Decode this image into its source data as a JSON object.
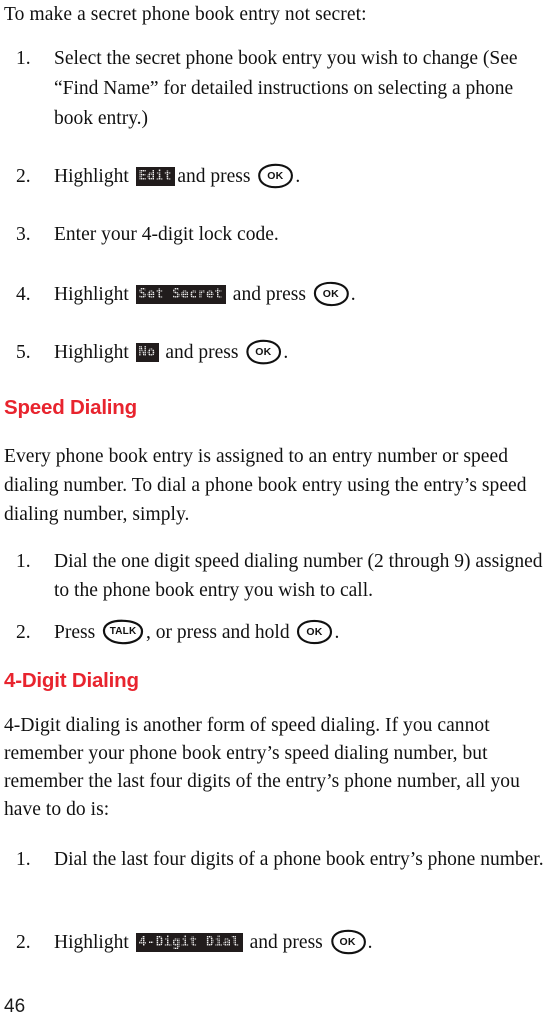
{
  "document": {
    "page_number": "46",
    "accent_color": "#e8242e",
    "lcd_background": "#211c1c",
    "lcd_foreground": "#f2f2f2"
  },
  "intro": {
    "text": "To make a secret phone book entry not secret:"
  },
  "secret_steps": [
    {
      "number": "1.",
      "text": "Select the secret phone book entry you wish to change  (See “Find Name” for detailed instructions on selecting a phone book entry.)"
    },
    {
      "number": "2.",
      "prefix": "Highlight",
      "lcd": "Edit",
      "middle": "and press",
      "key": "OK",
      "suffix": "."
    },
    {
      "number": "3.",
      "text": "Enter your 4-digit lock code."
    },
    {
      "number": "4.",
      "prefix": "Highlight",
      "lcd": "Set Secret",
      "middle": "and press",
      "key": "OK",
      "suffix": "."
    },
    {
      "number": "5.",
      "prefix": "Highlight",
      "lcd": "No",
      "middle": "and press",
      "key": "OK",
      "suffix": "."
    }
  ],
  "speed_dialing": {
    "heading": "Speed Dialing",
    "paragraph": "Every phone book entry is assigned to an entry number or speed dialing number. To dial a phone book entry using the entry’s speed dialing number, simply.",
    "steps": [
      {
        "number": "1.",
        "text": "Dial the one digit speed dialing number (2 through 9) assigned to the phone book entry you wish to call."
      },
      {
        "number": "2.",
        "prefix": "Press",
        "key1": "TALK",
        "middle": ", or press and hold",
        "key2": "OK",
        "suffix": "."
      }
    ]
  },
  "four_digit_dialing": {
    "heading": "4-Digit Dialing",
    "paragraph": "4-Digit dialing is another form of speed dialing. If you cannot remember your phone book entry’s speed dialing number, but remember the last four digits of the entry’s phone number, all you have to do is:",
    "steps": [
      {
        "number": "1.",
        "text": "Dial the last four digits of a phone book entry’s phone number."
      },
      {
        "number": "2.",
        "prefix": "Highlight",
        "lcd": "4-Digit Dial",
        "middle": "and press",
        "key": "OK",
        "suffix": "."
      }
    ]
  }
}
